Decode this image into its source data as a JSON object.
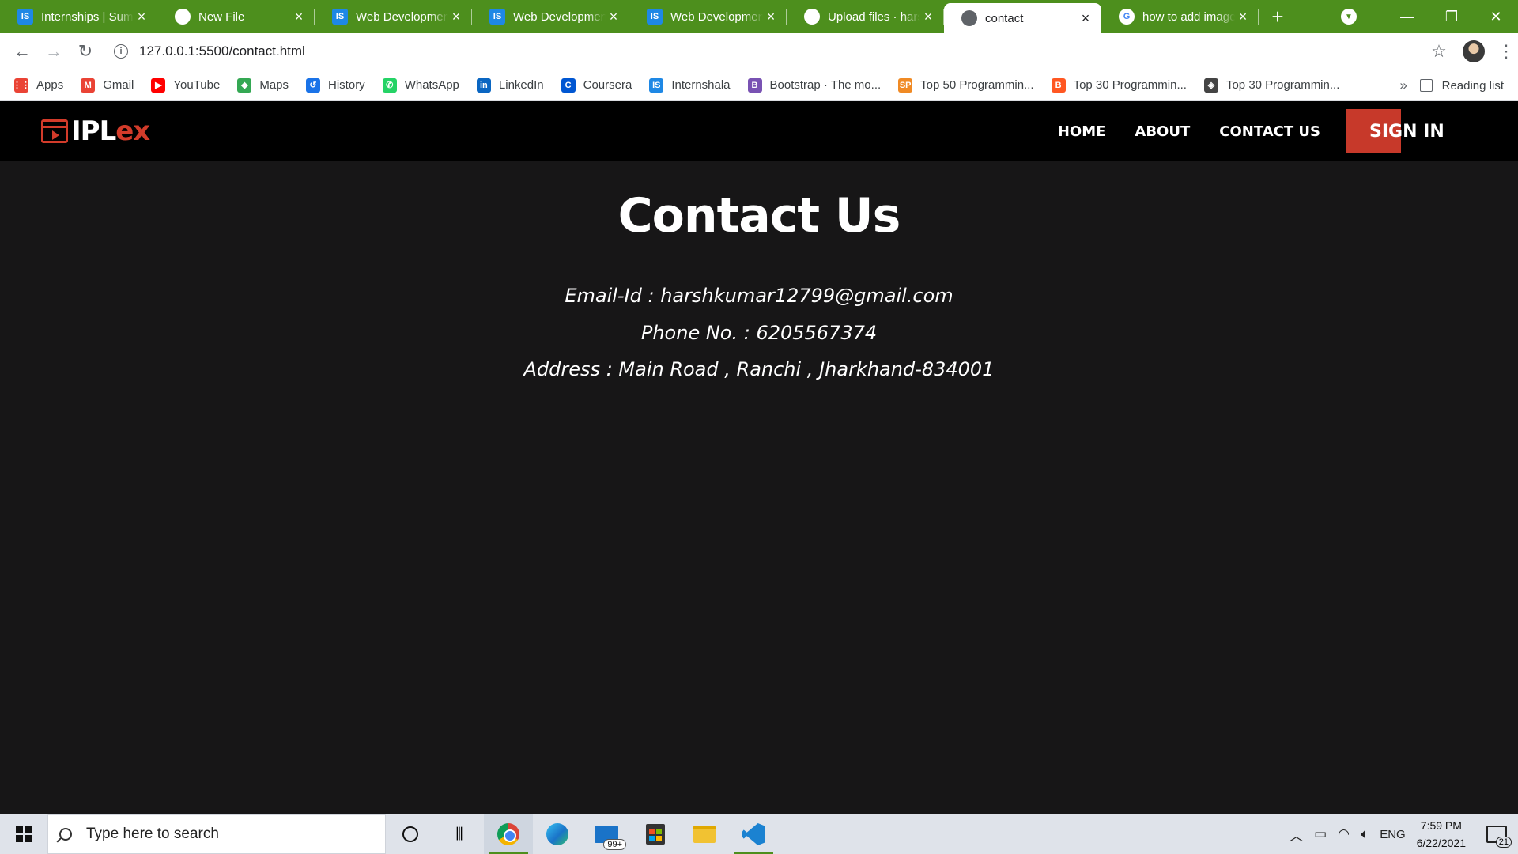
{
  "browser": {
    "tabs": [
      {
        "title": "Internships | Summer",
        "favicon": "IS",
        "icon": "internshala-icon",
        "active": false
      },
      {
        "title": "New File",
        "favicon": "",
        "icon": "github-icon",
        "active": false
      },
      {
        "title": "Web Development",
        "favicon": "IS",
        "icon": "internshala-icon",
        "active": false
      },
      {
        "title": "Web Development",
        "favicon": "IS",
        "icon": "internshala-icon",
        "active": false
      },
      {
        "title": "Web Development",
        "favicon": "IS",
        "icon": "internshala-icon",
        "active": false
      },
      {
        "title": "Upload files · harsh",
        "favicon": "",
        "icon": "github-icon",
        "active": false
      },
      {
        "title": "contact",
        "favicon": "",
        "icon": "globe-icon",
        "active": true
      },
      {
        "title": "how to add image",
        "favicon": "G",
        "icon": "google-icon",
        "active": false
      }
    ],
    "url": "127.0.0.1:5500/contact.html",
    "bookmarks": [
      {
        "label": "Apps",
        "icon": "apps-grid-icon",
        "color": "#ea4335",
        "glyph": "⋮⋮"
      },
      {
        "label": "Gmail",
        "icon": "gmail-icon",
        "color": "#ea4335",
        "glyph": "M"
      },
      {
        "label": "YouTube",
        "icon": "youtube-icon",
        "color": "#ff0000",
        "glyph": "▶"
      },
      {
        "label": "Maps",
        "icon": "maps-icon",
        "color": "#34a853",
        "glyph": "◆"
      },
      {
        "label": "History",
        "icon": "history-icon",
        "color": "#1a73e8",
        "glyph": "↺"
      },
      {
        "label": "WhatsApp",
        "icon": "whatsapp-icon",
        "color": "#25d366",
        "glyph": "✆"
      },
      {
        "label": "LinkedIn",
        "icon": "linkedin-icon",
        "color": "#0a66c2",
        "glyph": "in"
      },
      {
        "label": "Coursera",
        "icon": "coursera-icon",
        "color": "#0056d2",
        "glyph": "C"
      },
      {
        "label": "Internshala",
        "icon": "internshala-icon",
        "color": "#1e88e5",
        "glyph": "IS"
      },
      {
        "label": "Bootstrap · The mo...",
        "icon": "bootstrap-icon",
        "color": "#7952b3",
        "glyph": "B"
      },
      {
        "label": "Top 50 Programmin...",
        "icon": "sp-icon",
        "color": "#f08a24",
        "glyph": "SP"
      },
      {
        "label": "Top 30 Programmin...",
        "icon": "blogger-icon",
        "color": "#ff5722",
        "glyph": "B"
      },
      {
        "label": "Top 30 Programmin...",
        "icon": "site-icon",
        "color": "#444444",
        "glyph": "◈"
      }
    ],
    "more_bookmarks": "»",
    "reading_list": "Reading list"
  },
  "site": {
    "logo_main": "IPL",
    "logo_accent": "ex",
    "nav": [
      "HOME",
      "ABOUT",
      "CONTACT US"
    ],
    "sign_in": "SIGN IN",
    "accent_color": "#c7392a"
  },
  "contact": {
    "title": "Contact Us",
    "email_line": "Email-Id : harshkumar12799@gmail.com",
    "phone_line": "Phone No. : 6205567374",
    "address_line": "Address : Main Road , Ranchi , Jharkhand-834001"
  },
  "taskbar": {
    "search_placeholder": "Type here to search",
    "mail_badge": "99+",
    "language": "ENG",
    "time": "7:59 PM",
    "date": "6/22/2021",
    "notification_count": "21"
  }
}
